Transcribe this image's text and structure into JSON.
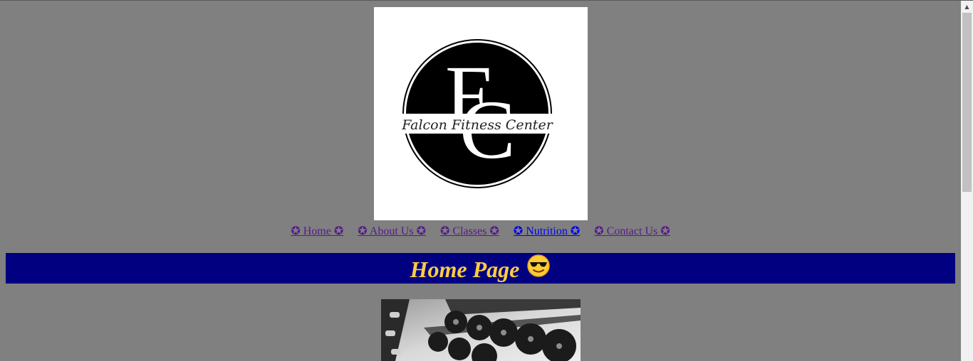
{
  "logo": {
    "monogram_f": "F",
    "monogram_c": "C",
    "script_text": "Falcon Fitness Center"
  },
  "nav": {
    "items": [
      {
        "label": "✪ Home ✪"
      },
      {
        "label": "✪ About Us ✪"
      },
      {
        "label": "✪ Classes ✪"
      },
      {
        "label": "✪ Nutrition ✪"
      },
      {
        "label": "✪ Contact Us ✪"
      }
    ]
  },
  "banner": {
    "title": "Home Page",
    "emoji": "sunglasses-smiley-icon"
  },
  "colors": {
    "page_background": "#808080",
    "banner_background": "#000080",
    "banner_text": "#ffcc44",
    "visited_link": "#551a8b",
    "active_link": "#0000ee"
  },
  "hero_image": {
    "subject": "dumbbell-rack"
  }
}
